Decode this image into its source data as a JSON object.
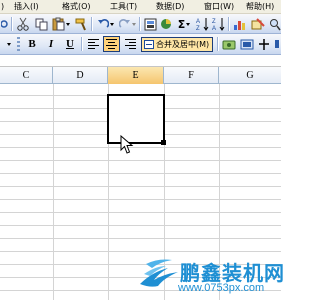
{
  "menubar": {
    "items": [
      {
        "name": "menu-insert",
        "label": "插入(I)"
      },
      {
        "name": "menu-format",
        "label": "格式(O)"
      },
      {
        "name": "menu-tools",
        "label": "工具(T)"
      },
      {
        "name": "menu-data",
        "label": "数据(D)"
      },
      {
        "name": "menu-window",
        "label": "窗口(W)"
      },
      {
        "name": "menu-help",
        "label": "帮助(H)"
      }
    ]
  },
  "toolbar": {
    "sum_label": "Σ",
    "bold_label": "B",
    "italic_label": "I",
    "underline_label": "U",
    "merge_center_label": "合并及居中(M)"
  },
  "columns": [
    "C",
    "D",
    "E",
    "F",
    "G"
  ],
  "active_column": "E",
  "colors": {
    "selection_border": "#000000",
    "grid_line": "#d4d4d4",
    "toolbar_blue": "#c8d7ef",
    "watermark_blue": "#1f8fd3"
  },
  "watermark": {
    "title": "鹏鑫装机网",
    "url": "www.0753px.com"
  }
}
